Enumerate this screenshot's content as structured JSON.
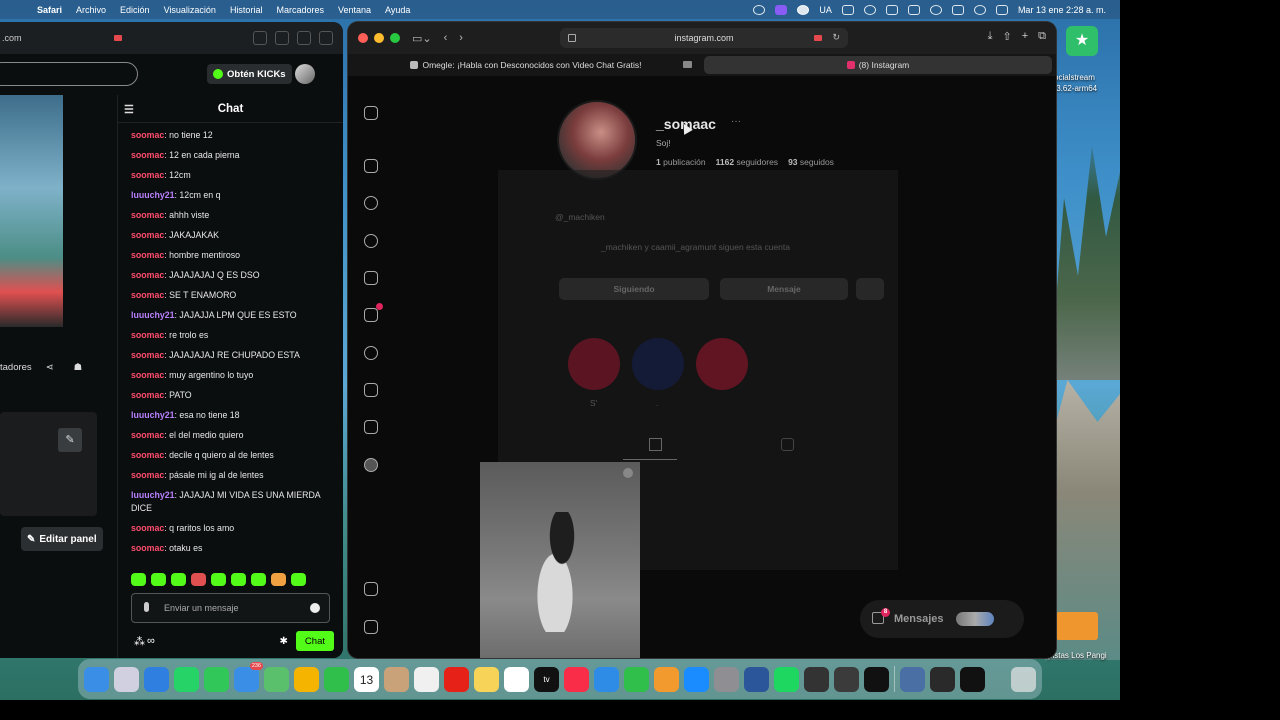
{
  "menubar": {
    "app": "Safari",
    "items": [
      "Archivo",
      "Edición",
      "Visualización",
      "Historial",
      "Marcadores",
      "Ventana",
      "Ayuda"
    ],
    "input_source": "UA",
    "datetime": "Mar 13 ene  2:28 a. m."
  },
  "desktop": {
    "app_label_line1": "ocialstream",
    "app_label_line2": ".3.62-arm64",
    "folder_label": "pistas Los Pangi"
  },
  "kick_window": {
    "url": ".com",
    "kicks_button": "Obtén KICKs",
    "panel_row_label": "tadores",
    "edit_panel_button": "Editar panel",
    "chat": {
      "title": "Chat",
      "messages": [
        {
          "user": "soomac",
          "text": ": no tiene 12",
          "color": "#ff4d6d"
        },
        {
          "user": "soomac",
          "text": ": 12 en cada pierna",
          "color": "#ff4d6d"
        },
        {
          "user": "soomac",
          "text": ": 12cm",
          "color": "#ff4d6d"
        },
        {
          "user": "luuuchy21",
          "text": ": 12cm en q",
          "color": "#b980ff"
        },
        {
          "user": "soomac",
          "text": ": ahhh viste",
          "color": "#ff4d6d"
        },
        {
          "user": "soomac",
          "text": ": JAKAJAKAK",
          "color": "#ff4d6d"
        },
        {
          "user": "soomac",
          "text": ": hombre mentiroso",
          "color": "#ff4d6d"
        },
        {
          "user": "soomac",
          "text": ": JAJAJAJAJ Q ES DSO",
          "color": "#ff4d6d"
        },
        {
          "user": "soomac",
          "text": ": SE T ENAMORO",
          "color": "#ff4d6d"
        },
        {
          "user": "luuuchy21",
          "text": ": JAJAJJA LPM QUE ES ESTO",
          "color": "#b980ff"
        },
        {
          "user": "soomac",
          "text": ": re trolo es",
          "color": "#ff4d6d"
        },
        {
          "user": "soomac",
          "text": ": JAJAJAJAJ RE CHUPADO ESTA",
          "color": "#ff4d6d"
        },
        {
          "user": "soomac",
          "text": ": muy argentino lo tuyo",
          "color": "#ff4d6d"
        },
        {
          "user": "soomac",
          "text": ": PATO",
          "color": "#ff4d6d"
        },
        {
          "user": "luuuchy21",
          "text": ": esa no tiene 18",
          "color": "#b980ff"
        },
        {
          "user": "soomac",
          "text": ": el del medio quiero",
          "color": "#ff4d6d"
        },
        {
          "user": "soomac",
          "text": ": decile q quiero al de lentes",
          "color": "#ff4d6d"
        },
        {
          "user": "soomac",
          "text": ": pásale mi ig al de lentes",
          "color": "#ff4d6d"
        },
        {
          "user": "luuuchy21",
          "text": ": JAJAJAJ MI VIDA ES UNA MIERDA DICE",
          "color": "#b980ff"
        },
        {
          "user": "soomac",
          "text": ": q raritos los amo",
          "color": "#ff4d6d"
        },
        {
          "user": "soomac",
          "text": ": otaku es",
          "color": "#ff4d6d"
        }
      ],
      "input_placeholder": "Enviar un mensaje",
      "infinity": "∞",
      "send_button": "Chat"
    }
  },
  "safari_window": {
    "address": "instagram.com",
    "tabs": [
      {
        "title": "Omegle: ¡Habla con Desconocidos con Video Chat Gratis!",
        "active": false
      },
      {
        "title": "(8) Instagram",
        "active": true
      }
    ],
    "profile": {
      "username": "_somaac",
      "bio": "Soj!",
      "posts": "1",
      "posts_label": "publicación",
      "followers": "1162",
      "followers_label": "seguidores",
      "following": "93",
      "following_label": "seguidos",
      "dim_sub_name": "@_machiken",
      "dim_followed_by": "_machiken y caamii_agramunt siguen esta cuenta",
      "following_button": "Siguiendo",
      "message_button": "Mensaje",
      "highlight_1": "S'",
      "highlight_2": ".",
      "notifications_badge": "8"
    },
    "messages_button": "Mensajes",
    "messages_badge": "8"
  },
  "dock": {
    "apps": [
      "finder",
      "launchpad",
      "safari",
      "whatsapp",
      "messages",
      "mail",
      "maps",
      "photos",
      "facetime",
      "calendar",
      "contacts",
      "reminders",
      "youtube",
      "notes",
      "freeform",
      "apple-tv",
      "music",
      "keynote",
      "numbers",
      "pages",
      "app-store",
      "system-settings",
      "word",
      "spotify",
      "cap",
      "obs",
      "capcut",
      "finder-2",
      "chrome-like",
      "tiktok"
    ],
    "calendar_date": "13",
    "mail_badge": "236",
    "tv_label": "tv"
  }
}
